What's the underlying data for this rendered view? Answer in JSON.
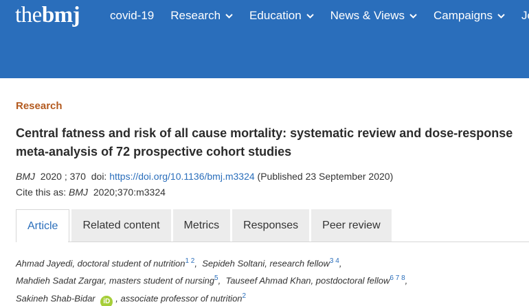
{
  "header": {
    "logo_the": "the",
    "logo_bmj": "bmj",
    "nav": [
      {
        "label": "covid-19",
        "has_dropdown": false
      },
      {
        "label": "Research",
        "has_dropdown": true
      },
      {
        "label": "Education",
        "has_dropdown": true
      },
      {
        "label": "News & Views",
        "has_dropdown": true
      },
      {
        "label": "Campaigns",
        "has_dropdown": true
      },
      {
        "label": "Jobs",
        "has_dropdown": false
      }
    ],
    "color": "#2a6ebb"
  },
  "article": {
    "section": "Research",
    "title": "Central fatness and risk of all cause mortality: systematic review and dose-response meta-analysis of 72 prospective cohort studies",
    "journal": "BMJ",
    "year": "2020",
    "volume": "370",
    "doi_label": "doi:",
    "doi": "https://doi.org/10.1136/bmj.m3324",
    "published": "(Published 23 September 2020)",
    "cite_label": "Cite this as:",
    "cite_journal": "BMJ",
    "cite_ref": "2020;370:m3324"
  },
  "tabs": [
    {
      "label": "Article",
      "active": true
    },
    {
      "label": "Related content",
      "active": false
    },
    {
      "label": "Metrics",
      "active": false
    },
    {
      "label": "Responses",
      "active": false
    },
    {
      "label": "Peer review",
      "active": false
    }
  ],
  "authors": {
    "a1": "Ahmad Jayedi, doctoral student of nutrition",
    "a1_sup": "1 2",
    "a2": "Sepideh Soltani, research fellow",
    "a2_sup": "3 4",
    "a3": "Mahdieh Sadat Zargar, masters student of nursing",
    "a3_sup": "5",
    "a4": "Tauseef Ahmad Khan, postdoctoral fellow",
    "a4_sup": "6 7 8",
    "a5_name": "Sakineh Shab-Bidar",
    "orcid_label": "iD",
    "a5_role": ", associate professor of nutrition",
    "a5_sup": "2"
  }
}
